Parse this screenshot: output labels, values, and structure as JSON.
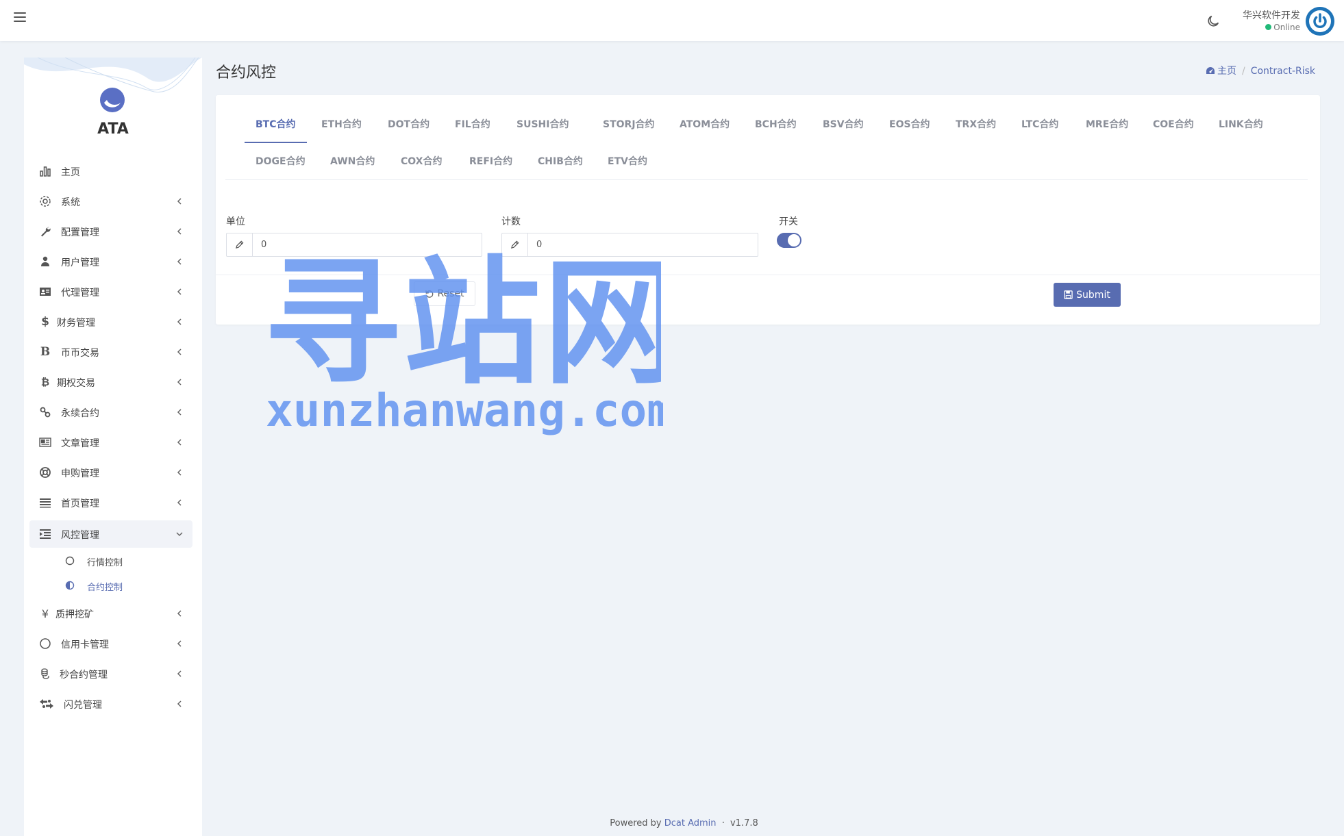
{
  "navbar": {
    "user_name": "华兴软件开发",
    "user_status": "Online",
    "status_color": "#21b978"
  },
  "sidebar": {
    "brand": "ATA",
    "items": [
      {
        "label": "主页",
        "icon": "bar-chart-icon"
      },
      {
        "label": "系统",
        "icon": "gear-icon"
      },
      {
        "label": "配置管理",
        "icon": "wrench-icon"
      },
      {
        "label": "用户管理",
        "icon": "users-icon"
      },
      {
        "label": "代理管理",
        "icon": "id-card-icon"
      },
      {
        "label": "财务管理",
        "icon": "dollar-icon"
      },
      {
        "label": "币币交易",
        "icon": "bold-b-icon"
      },
      {
        "label": "期权交易",
        "icon": "bitcoin-icon"
      },
      {
        "label": "永续合约",
        "icon": "link-icon"
      },
      {
        "label": "文章管理",
        "icon": "newspaper-icon"
      },
      {
        "label": "申购管理",
        "icon": "lifebuoy-icon"
      },
      {
        "label": "首页管理",
        "icon": "list-icon"
      },
      {
        "label": "风控管理",
        "icon": "indent-icon"
      },
      {
        "label": "质押挖矿",
        "icon": "yen-icon"
      },
      {
        "label": "信用卡管理",
        "icon": "circle-icon"
      },
      {
        "label": "秒合约管理",
        "icon": "coins-icon"
      },
      {
        "label": "闪兑管理",
        "icon": "exchange-icon"
      }
    ],
    "sub_items": [
      {
        "label": "行情控制"
      },
      {
        "label": "合约控制"
      }
    ]
  },
  "page": {
    "title": "合约风控",
    "breadcrumb_home": "主页",
    "breadcrumb_current": "Contract-Risk"
  },
  "tabs": [
    "BTC合约",
    "ETH合约",
    "DOT合约",
    "FIL合约",
    "SUSHI合约",
    "STORJ合约",
    "ATOM合约",
    "BCH合约",
    "BSV合约",
    "EOS合约",
    "TRX合约",
    "LTC合约",
    "MRE合约",
    "COE合约",
    "LINK合约",
    "DOGE合约",
    "AWN合约",
    "COX合约",
    "REFI合约",
    "CHIB合约",
    "ETV合约"
  ],
  "form": {
    "unit_label": "单位",
    "unit_value": "0",
    "count_label": "计数",
    "count_value": "0",
    "switch_label": "开关",
    "switch_on": true,
    "reset_label": "Reset",
    "submit_label": "Submit"
  },
  "watermark": {
    "cn": "寻站网",
    "en": "xunzhanwang.com"
  },
  "footer": {
    "powered_by": "Powered by",
    "framework": "Dcat Admin",
    "separator": "·",
    "version": "v1.7.8"
  },
  "colors": {
    "accent": "#586cb1",
    "background": "#eff3f8",
    "watermark": "#5b8ef0"
  }
}
